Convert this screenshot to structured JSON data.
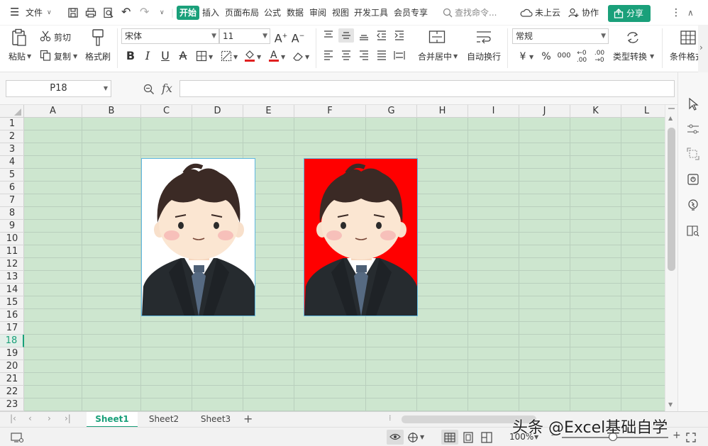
{
  "menubar": {
    "file_label": "文件",
    "tabs": [
      "开始",
      "插入",
      "页面布局",
      "公式",
      "数据",
      "审阅",
      "视图",
      "开发工具",
      "会员专享"
    ],
    "search_placeholder": "查找命令...",
    "cloud_label": "未上云",
    "collab_label": "协作",
    "share_label": "分享"
  },
  "ribbon": {
    "paste_label": "粘贴",
    "cut_label": "剪切",
    "copy_label": "复制",
    "format_painter_label": "格式刷",
    "font_name": "宋体",
    "font_size": "11",
    "merge_center_label": "合并居中",
    "wrap_text_label": "自动换行",
    "number_format": "常规",
    "type_convert_label": "类型转换",
    "cond_format_label": "条件格式"
  },
  "formula_bar": {
    "cell_ref": "P18",
    "fx_label": "fx",
    "formula": ""
  },
  "grid": {
    "columns": [
      "A",
      "B",
      "C",
      "D",
      "E",
      "F",
      "G",
      "H",
      "I",
      "J",
      "K",
      "L"
    ],
    "rows": [
      "1",
      "2",
      "3",
      "4",
      "5",
      "6",
      "7",
      "8",
      "9",
      "10",
      "11",
      "12",
      "13",
      "14",
      "15",
      "16",
      "17",
      "18",
      "19",
      "20",
      "21",
      "22",
      "23"
    ],
    "active_row": "18",
    "cell_background": "#cde6cf",
    "picture_backgrounds": [
      "#ffffff",
      "#ff0000"
    ]
  },
  "sheets": {
    "tabs": [
      "Sheet1",
      "Sheet2",
      "Sheet3"
    ],
    "active": "Sheet1",
    "add_label": "+"
  },
  "statusbar": {
    "zoom": "100%"
  },
  "watermark": "头条 @Excel基础自学",
  "colors": {
    "accent": "#1aa07a"
  }
}
